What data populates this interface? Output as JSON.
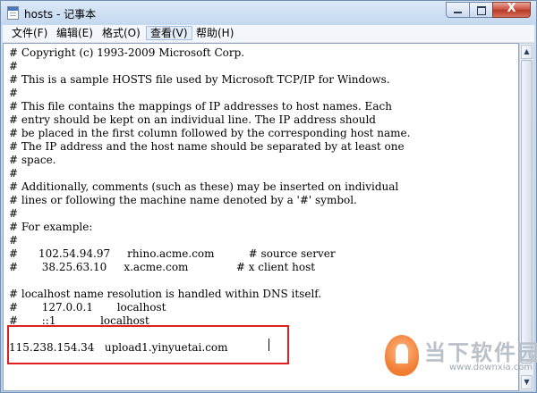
{
  "window": {
    "title": "hosts - 记事本"
  },
  "menu": [
    {
      "label": "文件(F)"
    },
    {
      "label": "编辑(E)"
    },
    {
      "label": "格式(O)"
    },
    {
      "label": "查看(V)"
    },
    {
      "label": "帮助(H)"
    }
  ],
  "caption_buttons": {
    "close_glyph": "X"
  },
  "editor": {
    "lines": [
      "# Copyright (c) 1993-2009 Microsoft Corp.",
      "#",
      "# This is a sample HOSTS file used by Microsoft TCP/IP for Windows.",
      "#",
      "# This file contains the mappings of IP addresses to host names. Each",
      "# entry should be kept on an individual line. The IP address should",
      "# be placed in the first column followed by the corresponding host name.",
      "# The IP address and the host name should be separated by at least one",
      "# space.",
      "#",
      "# Additionally, comments (such as these) may be inserted on individual",
      "# lines or following the machine name denoted by a '#' symbol.",
      "#",
      "# For example:",
      "#",
      "#      102.54.94.97     rhino.acme.com          # source server",
      "#       38.25.63.10     x.acme.com              # x client host",
      "",
      "# localhost name resolution is handled within DNS itself.",
      "#       127.0.0.1       localhost",
      "#       ::1             localhost",
      "",
      "115.238.154.34   upload1.yinyuetai.com"
    ]
  },
  "watermark": {
    "brand": "当下软件园",
    "url": "www.downxia.com"
  },
  "colors": {
    "highlight_border": "#e02020",
    "watermark_orange": "#f07020"
  }
}
